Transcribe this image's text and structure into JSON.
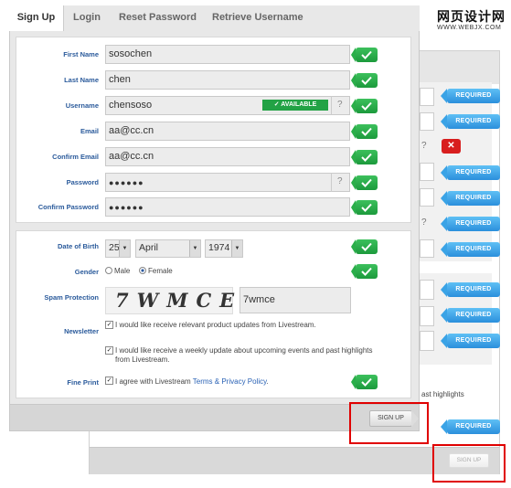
{
  "watermark": {
    "title": "网页设计网",
    "url": "WWW.WEBJX.COM"
  },
  "tabs": [
    {
      "label": "Sign Up"
    },
    {
      "label": "Login"
    },
    {
      "label": "Reset Password"
    },
    {
      "label": "Retrieve Username"
    }
  ],
  "form": {
    "first_name": {
      "label": "First Name",
      "value": "sosochen"
    },
    "last_name": {
      "label": "Last Name",
      "value": "chen"
    },
    "username": {
      "label": "Username",
      "value": "chensoso",
      "status": "✓ AVAILABLE",
      "help": "?"
    },
    "email": {
      "label": "Email",
      "value": "aa@cc.cn"
    },
    "confirm_email": {
      "label": "Confirm Email",
      "value": "aa@cc.cn"
    },
    "password": {
      "label": "Password",
      "value": "●●●●●●",
      "help": "?"
    },
    "confirm_password": {
      "label": "Confirm Password",
      "value": "●●●●●●"
    },
    "dob": {
      "label": "Date of Birth",
      "day": "25",
      "month": "April",
      "year": "1974"
    },
    "gender": {
      "label": "Gender",
      "male": "Male",
      "female": "Female",
      "selected": "Female"
    },
    "spam": {
      "label": "Spam Protection",
      "captcha": "7WMCE",
      "value": "7wmce"
    },
    "newsletter": {
      "label": "Newsletter",
      "opt1": "I would like receive relevant product updates from Livestream.",
      "opt2a": "I would like receive a weekly update about upcoming events and past highlights",
      "opt2b": "from Livestream."
    },
    "fine_print": {
      "label": "Fine Print",
      "text": "I agree with Livestream ",
      "link": "Terms & Privacy Policy",
      "end": "."
    }
  },
  "signup_label": "SIGN UP",
  "background": {
    "required_label": "REQUIRED",
    "error_label": "✕",
    "highlight_text": "ast highlights",
    "signup_label": "SIGN UP"
  },
  "colors": {
    "accent": "#2b8fdc",
    "success": "#22a245",
    "error": "#d81e1e",
    "highlight": "#e00000"
  }
}
